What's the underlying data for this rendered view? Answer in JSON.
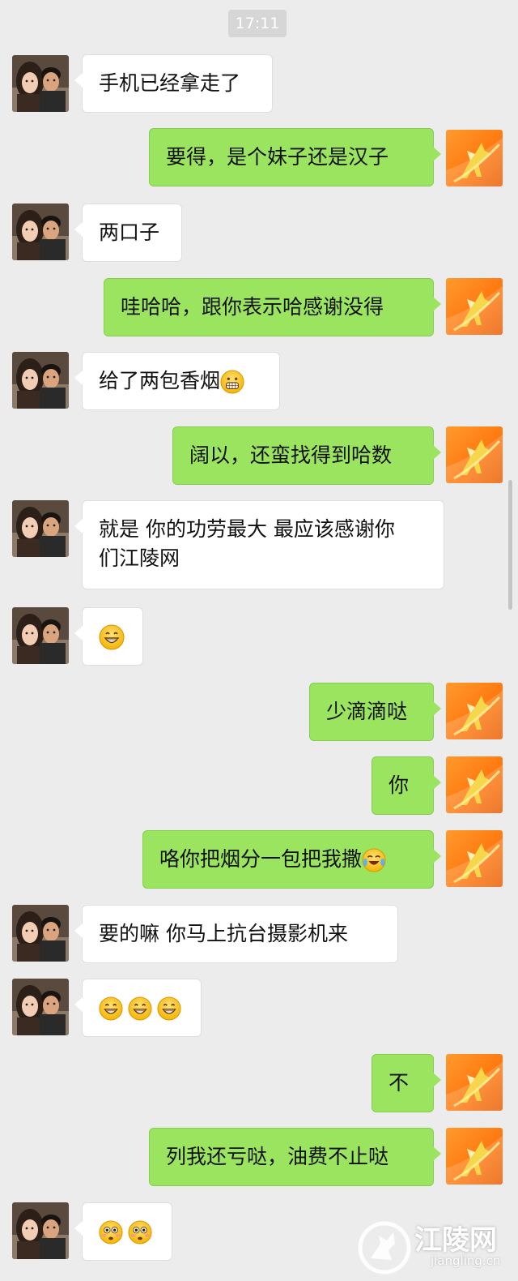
{
  "timestamp": "17:11",
  "contact_avatar_icon": "couple-photo-avatar",
  "self_avatar_icon": "orange-fox-logo-avatar",
  "colors": {
    "background": "#ececec",
    "incoming_bubble": "#ffffff",
    "outgoing_bubble": "#9be45f"
  },
  "messages": [
    {
      "side": "left",
      "text": "手机已经拿走了"
    },
    {
      "side": "right",
      "text": "要得，是个妹子还是汉子"
    },
    {
      "side": "left",
      "text": "两口子"
    },
    {
      "side": "right",
      "text": "哇哈哈，跟你表示哈感谢没得"
    },
    {
      "side": "left",
      "text": "给了两包香烟",
      "emoji": "grimace-emoji"
    },
    {
      "side": "right",
      "text": "阔以，还蛮找得到哈数"
    },
    {
      "side": "left",
      "text_line1": "就是 你的功劳最大 最应该感谢你",
      "text_line2": "们江陵网"
    },
    {
      "side": "left",
      "emoji": "grin-emoji"
    },
    {
      "side": "right",
      "text": "少滴滴哒"
    },
    {
      "side": "right",
      "text": "你"
    },
    {
      "side": "right",
      "text": "咯你把烟分一包把我撒",
      "emoji": "crying-laughing-emoji"
    },
    {
      "side": "left",
      "text": "要的嘛 你马上抗台摄影机来"
    },
    {
      "side": "left",
      "emoji": "grin-emoji-x3"
    },
    {
      "side": "right",
      "text": "不"
    },
    {
      "side": "right",
      "text": "列我还亏哒，油费不止哒"
    },
    {
      "side": "left",
      "emoji": "flushed-emoji-x2"
    }
  ],
  "watermark": {
    "name": "江陵网",
    "domain": "jiangling.cn"
  }
}
